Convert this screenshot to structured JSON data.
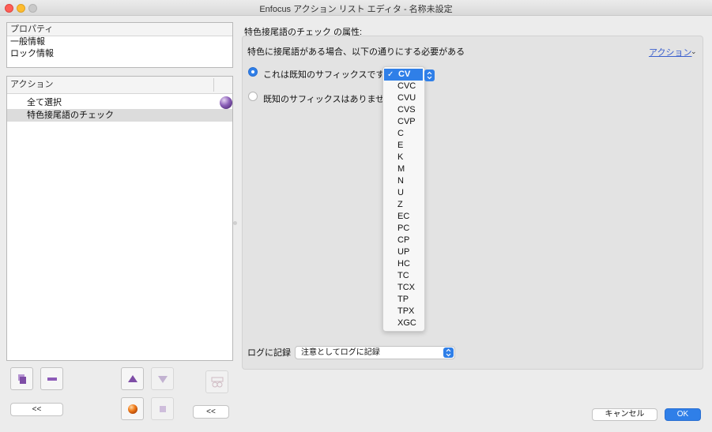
{
  "window": {
    "title": "Enfocus アクション リスト エディタ - 名称未設定"
  },
  "properties_panel": {
    "header": "プロパティ",
    "items": [
      "一般情報",
      "ロック情報"
    ]
  },
  "actions_panel": {
    "header": "アクション",
    "rows": [
      "全て選択",
      "特色接尾語のチェック"
    ]
  },
  "toolbar": {
    "collapse_label_1": "<<",
    "collapse_label_2": "<<"
  },
  "right": {
    "title": "特色接尾語のチェック の属性:",
    "description": "特色に接尾語がある場合、以下の通りにする必要がある",
    "action_link": "アクション",
    "radio_known": "これは既知のサフィックスです：",
    "radio_unknown": "既知のサフィックスはありません",
    "suffix_selected": "CV",
    "suffix_options": [
      "CV",
      "CVC",
      "CVU",
      "CVS",
      "CVP",
      "C",
      "E",
      "K",
      "M",
      "N",
      "U",
      "Z",
      "EC",
      "PC",
      "CP",
      "UP",
      "HC",
      "TC",
      "TCX",
      "TP",
      "TPX",
      "XGC"
    ],
    "log_label": "ログに記録",
    "log_value": "注意としてログに記録"
  },
  "buttons": {
    "cancel": "キャンセル",
    "ok": "OK"
  },
  "colors": {
    "accent": "#2f7fe8",
    "link": "#3a5fcd"
  }
}
